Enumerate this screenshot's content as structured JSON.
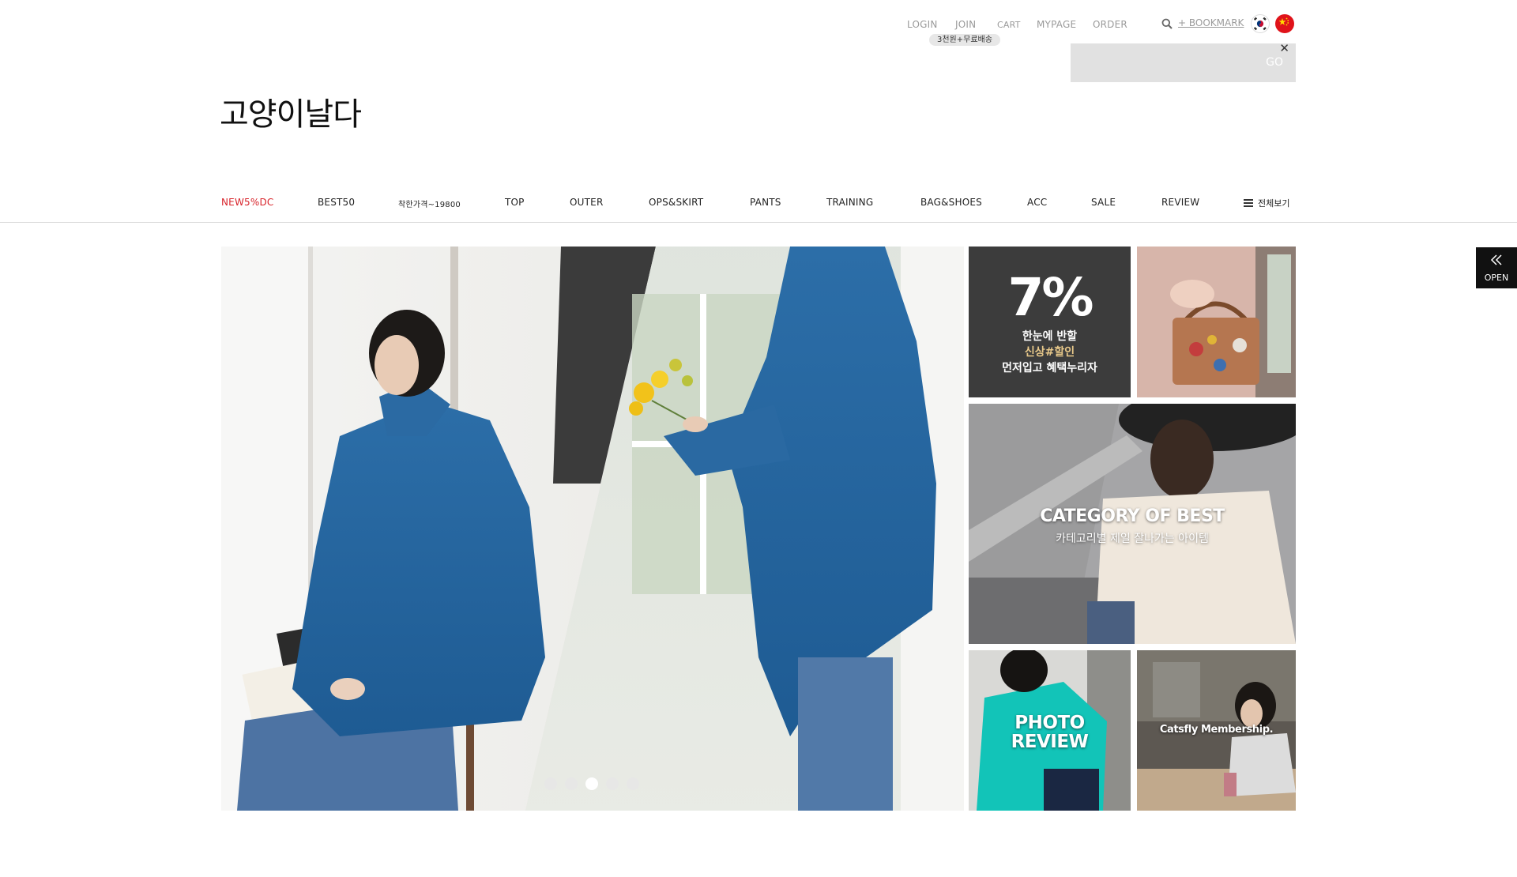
{
  "util_menu": {
    "login": "LOGIN",
    "join": "JOIN",
    "cart": "CART",
    "mypage": "MYPAGE",
    "order": "ORDER",
    "join_badge": "3천원+무료배송",
    "bookmark": "+ BOOKMARK"
  },
  "search": {
    "placeholder": "",
    "go_label": "GO",
    "close_label": "✕"
  },
  "logo": "고양이날다",
  "nav": {
    "items": [
      "NEW5%DC",
      "BEST50",
      "착한가격~19800",
      "TOP",
      "OUTER",
      "OPS&SKIRT",
      "PANTS",
      "TRAINING",
      "BAG&SHOES",
      "ACC",
      "SALE",
      "REVIEW"
    ],
    "all_view": "전체보기",
    "highlight_color": "#d8232a"
  },
  "hero": {
    "slide_count": 5,
    "active_slide": 3
  },
  "banners": {
    "discount": {
      "big": "7%",
      "line1": "한눈에 반할",
      "line2": "신상#할인",
      "line3": "먼저입고 혜택누리자"
    },
    "category": {
      "title": "CATEGORY OF BEST",
      "subtitle": "카테고리별 제일 잘나가는 아이템"
    },
    "photo_review": {
      "line1": "PHOTO",
      "line2": "REVIEW"
    },
    "membership": {
      "title": "Catsfly Membership."
    }
  },
  "side_tab": {
    "label": "OPEN"
  },
  "icons": {
    "search": "search-icon",
    "korea_flag": "korea-flag-icon",
    "china_flag": "china-flag-icon",
    "hamburger": "hamburger-icon",
    "double_chevron": "double-chevron-left-icon"
  }
}
